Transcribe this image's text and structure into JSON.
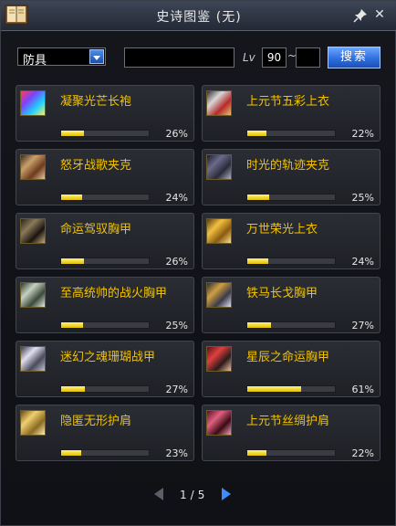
{
  "window": {
    "title": "史诗图鉴 (无)"
  },
  "filters": {
    "type_value": "防具",
    "name_value": "",
    "lv_label": "Lv",
    "lv_min": "90",
    "lv_separator": "~",
    "lv_max": "",
    "search_label": "搜索"
  },
  "items": [
    {
      "name": "凝聚光芒长袍",
      "percent": "26%",
      "progress": 0.26,
      "icon": "robe-icon"
    },
    {
      "name": "上元节五彩上衣",
      "percent": "22%",
      "progress": 0.22,
      "icon": "festival-jacket-icon"
    },
    {
      "name": "怒牙战歌夹克",
      "percent": "24%",
      "progress": 0.24,
      "icon": "leather-jacket-icon"
    },
    {
      "name": "时光的轨迹夹克",
      "percent": "25%",
      "progress": 0.25,
      "icon": "time-jacket-icon"
    },
    {
      "name": "命运驾驭胸甲",
      "percent": "26%",
      "progress": 0.26,
      "icon": "chest-armor-icon"
    },
    {
      "name": "万世荣光上衣",
      "percent": "24%",
      "progress": 0.24,
      "icon": "glory-top-icon"
    },
    {
      "name": "至高统帅的战火胸甲",
      "percent": "25%",
      "progress": 0.25,
      "icon": "commander-armor-icon"
    },
    {
      "name": "铁马长戈胸甲",
      "percent": "27%",
      "progress": 0.27,
      "icon": "iron-armor-icon"
    },
    {
      "name": "迷幻之魂珊瑚战甲",
      "percent": "27%",
      "progress": 0.27,
      "icon": "coral-armor-icon"
    },
    {
      "name": "星辰之命运胸甲",
      "percent": "61%",
      "progress": 0.61,
      "icon": "star-armor-icon"
    },
    {
      "name": "隐匿无形护肩",
      "percent": "23%",
      "progress": 0.23,
      "icon": "shoulder-icon"
    },
    {
      "name": "上元节丝绸护肩",
      "percent": "22%",
      "progress": 0.22,
      "icon": "silk-shoulder-icon"
    }
  ],
  "pager": {
    "current": "1",
    "sep": "/",
    "total": "5"
  },
  "colors": {
    "accent": "#2f6fe0",
    "item_name": "#f2c200",
    "progress": "#f0d400"
  }
}
